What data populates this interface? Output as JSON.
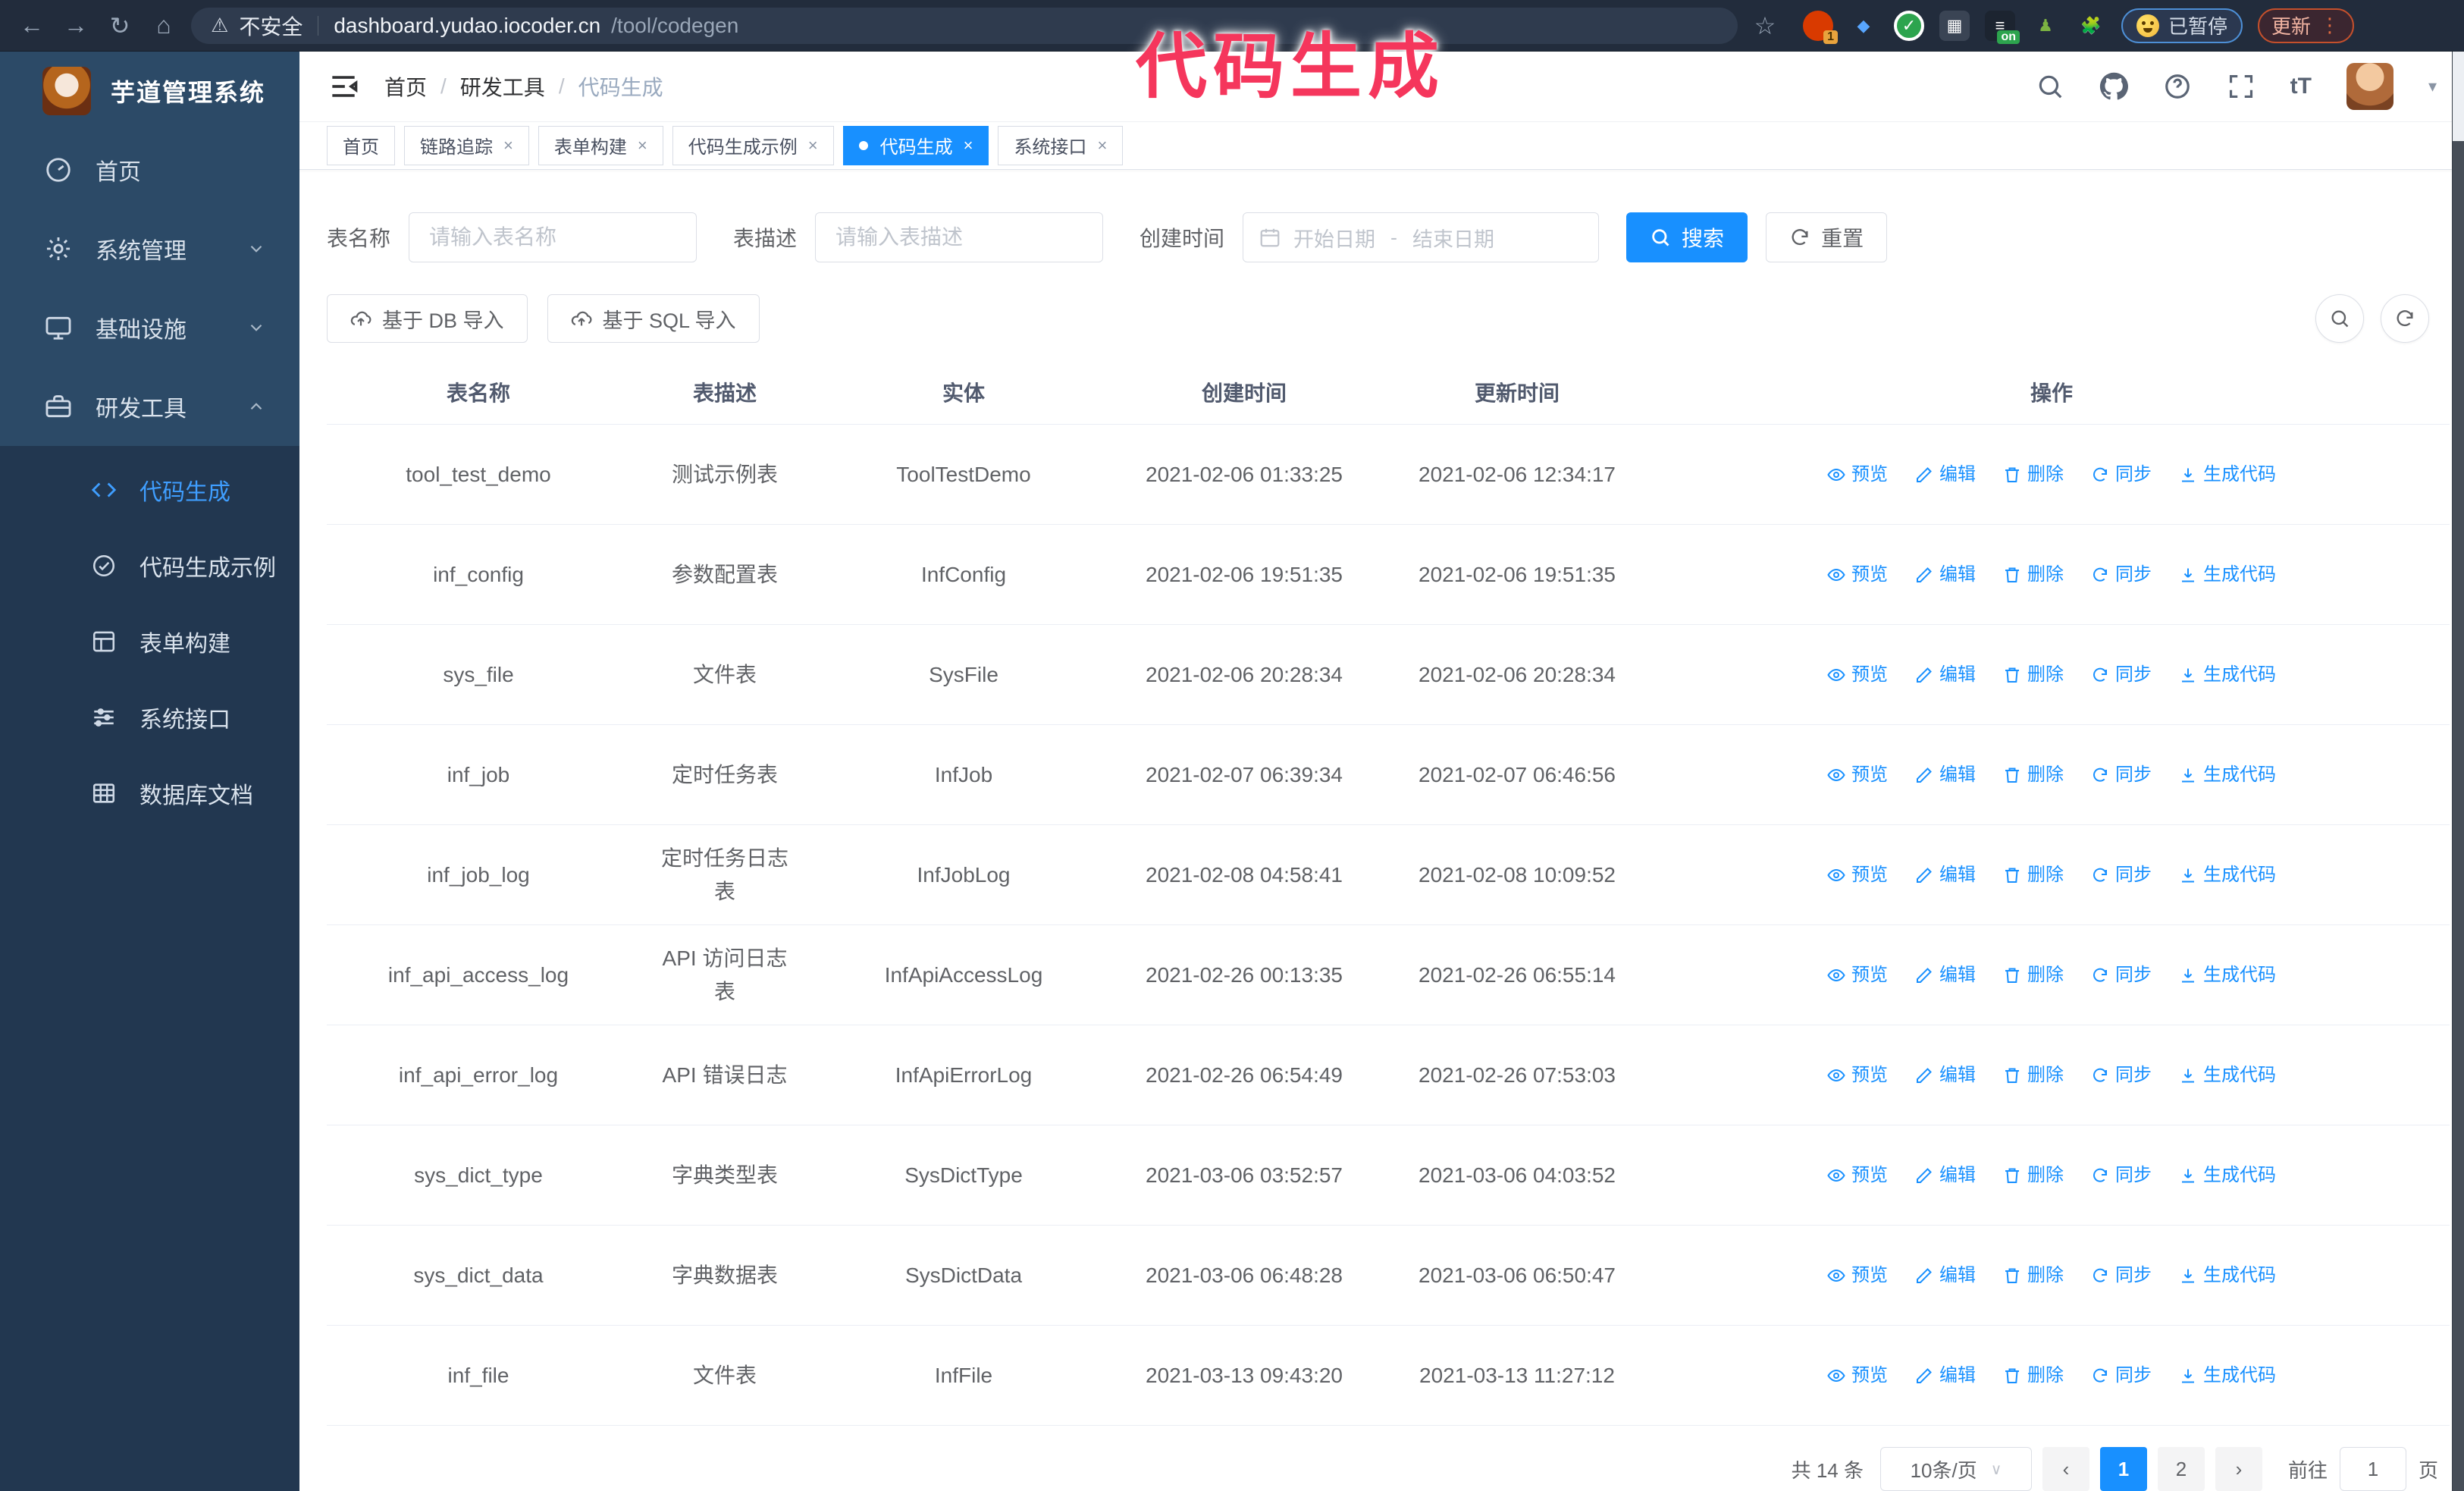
{
  "browser": {
    "security_warning": "不安全",
    "url_host": "dashboard.yudao.iocoder.cn",
    "url_path": "/tool/codegen",
    "extension_badge_count": "1",
    "extension_badge_on": "on",
    "paused_badge": "已暂停",
    "update_button": "更新"
  },
  "annotation": {
    "text": "代码生成",
    "color": "#f5365c"
  },
  "sidebar": {
    "logo_title": "芋道管理系统",
    "items": [
      {
        "label": "首页",
        "icon": "dashboard-icon"
      },
      {
        "label": "系统管理",
        "icon": "gear-icon"
      },
      {
        "label": "基础设施",
        "icon": "monitor-icon"
      },
      {
        "label": "研发工具",
        "icon": "toolbox-icon"
      }
    ],
    "submenu": [
      {
        "label": "代码生成",
        "icon": "code-icon",
        "active": true
      },
      {
        "label": "代码生成示例",
        "icon": "check-badge-icon"
      },
      {
        "label": "表单构建",
        "icon": "form-icon"
      },
      {
        "label": "系统接口",
        "icon": "sliders-icon"
      },
      {
        "label": "数据库文档",
        "icon": "table-grid-icon"
      }
    ]
  },
  "breadcrumb": {
    "items": [
      "首页",
      "研发工具",
      "代码生成"
    ],
    "separator": "/"
  },
  "tabs": [
    {
      "label": "首页"
    },
    {
      "label": "链路追踪"
    },
    {
      "label": "表单构建"
    },
    {
      "label": "代码生成示例"
    },
    {
      "label": "代码生成"
    },
    {
      "label": "系统接口"
    }
  ],
  "search_form": {
    "table_name_label": "表名称",
    "table_name_placeholder": "请输入表名称",
    "table_desc_label": "表描述",
    "table_desc_placeholder": "请输入表描述",
    "create_time_label": "创建时间",
    "date_start_placeholder": "开始日期",
    "date_separator": "-",
    "date_end_placeholder": "结束日期",
    "search_button": "搜索",
    "reset_button": "重置"
  },
  "toolbar": {
    "import_db_button": "基于 DB 导入",
    "import_sql_button": "基于 SQL 导入"
  },
  "table": {
    "columns": [
      "表名称",
      "表描述",
      "实体",
      "创建时间",
      "更新时间",
      "操作"
    ],
    "actions": [
      "预览",
      "编辑",
      "删除",
      "同步",
      "生成代码"
    ],
    "rows": [
      {
        "name": "tool_test_demo",
        "desc": "测试示例表",
        "entity": "ToolTestDemo",
        "created": "2021-02-06 01:33:25",
        "updated": "2021-02-06 12:34:17"
      },
      {
        "name": "inf_config",
        "desc": "参数配置表",
        "entity": "InfConfig",
        "created": "2021-02-06 19:51:35",
        "updated": "2021-02-06 19:51:35"
      },
      {
        "name": "sys_file",
        "desc": "文件表",
        "entity": "SysFile",
        "created": "2021-02-06 20:28:34",
        "updated": "2021-02-06 20:28:34"
      },
      {
        "name": "inf_job",
        "desc": "定时任务表",
        "entity": "InfJob",
        "created": "2021-02-07 06:39:34",
        "updated": "2021-02-07 06:46:56"
      },
      {
        "name": "inf_job_log",
        "desc": "定时任务日志表",
        "entity": "InfJobLog",
        "created": "2021-02-08 04:58:41",
        "updated": "2021-02-08 10:09:52"
      },
      {
        "name": "inf_api_access_log",
        "desc": "API 访问日志表",
        "entity": "InfApiAccessLog",
        "created": "2021-02-26 00:13:35",
        "updated": "2021-02-26 06:55:14"
      },
      {
        "name": "inf_api_error_log",
        "desc": "API 错误日志",
        "entity": "InfApiErrorLog",
        "created": "2021-02-26 06:54:49",
        "updated": "2021-02-26 07:53:03"
      },
      {
        "name": "sys_dict_type",
        "desc": "字典类型表",
        "entity": "SysDictType",
        "created": "2021-03-06 03:52:57",
        "updated": "2021-03-06 04:03:52"
      },
      {
        "name": "sys_dict_data",
        "desc": "字典数据表",
        "entity": "SysDictData",
        "created": "2021-03-06 06:48:28",
        "updated": "2021-03-06 06:50:47"
      },
      {
        "name": "inf_file",
        "desc": "文件表",
        "entity": "InfFile",
        "created": "2021-03-13 09:43:20",
        "updated": "2021-03-13 11:27:12"
      }
    ]
  },
  "pagination": {
    "total_text": "共 14 条",
    "page_size": "10条/页",
    "pages": [
      "1",
      "2"
    ],
    "active_page": "1",
    "goto_label": "前往",
    "goto_value": "1",
    "goto_suffix": "页"
  },
  "colors": {
    "primary": "#1890ff",
    "sidebar_bg": "#2c4a67",
    "submenu_bg": "#223750",
    "browser_bar_bg": "#222c3c",
    "annotation": "#f5365c",
    "active_menu_text": "#3f9eff"
  }
}
